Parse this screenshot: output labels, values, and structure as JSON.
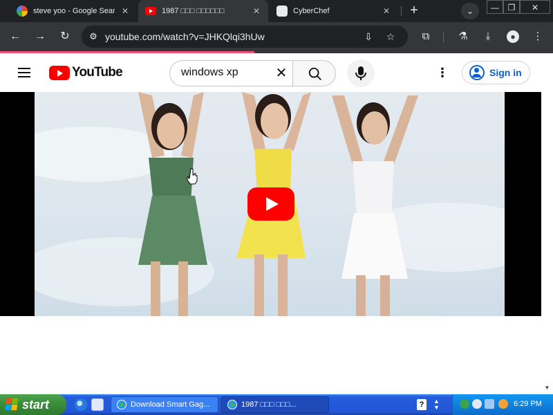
{
  "browser": {
    "tabs": [
      {
        "title": "steve yoo - Google Search",
        "favicon": "google-icon",
        "active": false
      },
      {
        "title": "1987 □□□ □□□□□□",
        "favicon": "youtube-icon",
        "active": true
      },
      {
        "title": "CyberChef",
        "favicon": "cyberchef-icon",
        "active": false
      }
    ],
    "url": "youtube.com/watch?v=JHKQlqi3hUw",
    "load_progress": 0.46
  },
  "youtube": {
    "logo_text": "YouTube",
    "search": {
      "value": "windows xp",
      "placeholder": "Search"
    },
    "sign_in_label": "Sign in"
  },
  "taskbar": {
    "start_label": "start",
    "tasks": [
      {
        "label": "Download Smart Gag...",
        "active": false
      },
      {
        "label": "1987 □□□ □□□...",
        "active": true
      }
    ],
    "clock": "6:29 PM"
  },
  "colors": {
    "youtube_red": "#ff0000",
    "link_blue": "#065fd4",
    "load_bar": "#f44e7a",
    "xp_blue": "#245edb",
    "xp_green": "#3c8f3c"
  }
}
